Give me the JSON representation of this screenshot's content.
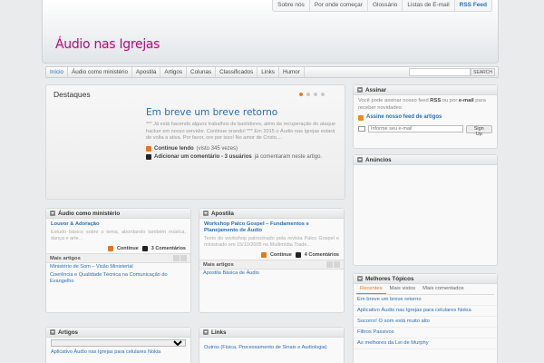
{
  "toplinks": [
    "Sobre nós",
    "Por onde começar",
    "Glossário",
    "Listas de E-mail",
    "RSS Feed"
  ],
  "logo": "Áudio nas Igrejas",
  "nav": [
    "Início",
    "Áudio como ministério",
    "Apostila",
    "Artigos",
    "Colunas",
    "Classificados",
    "Links",
    "Humor"
  ],
  "search_button": "SEARCH",
  "featured": {
    "title": "Destaques",
    "article_title": "Em breve um breve retorno",
    "excerpt": "*** Já está havendo alguns trabalhos de bastidores, além da recuperação do ataque hacker em nosso servidor. Continue orando! *** Em 2015 o Áudio nas Igrejas estará de volta a ativa. Por favor, ore por isso! No amor de Cristo,...",
    "read_more": "Continue lendo",
    "views": "(visto 345 vezes)",
    "comment": "Adicionar um comentário - 3 usuários",
    "comment_suffix": "já comentaram neste artigo."
  },
  "col1": {
    "header": "Áudio como ministério",
    "post_title": "Louvor & Adoração",
    "excerpt": "Estudo básico sobre o tema, abordando também música, dança e arte...",
    "continue": "Continue",
    "comments": "3 Comentários",
    "more_label": "Mais artigos",
    "more_links": [
      "Ministério de Som – Visão Ministerial",
      "Coerência e Qualidade Técnica na Comunicação do Evangelho"
    ]
  },
  "col2": {
    "header": "Apostila",
    "post_title": "Workshop Palco Gospel – Fundamentos e Planejamento de Áudio",
    "excerpt": "Texto do workshop patrocinado pela revista Palco Gospel e ministrado em 15/10/2005 no Multimídia Trade...",
    "continue": "Continue",
    "comments": "4 Comentários",
    "more_label": "Mais artigos",
    "more_links": [
      "Apostila Básica de Áudio"
    ]
  },
  "artigos": {
    "header": "Artigos",
    "first_link": "Aplicativo Áudio nas Igrejas para celulares Nokia"
  },
  "links": {
    "header": "Links",
    "first_link": "Outros (Física, Processamento de Sinais e Audiologia)"
  },
  "assinar": {
    "header": "Assinar",
    "text_a": "Você pode assinar nosso feed",
    "rss": "RSS",
    "text_b": "ou por",
    "email": "e-mail",
    "text_c": "para receber novidades:",
    "feed_link": "Assine nosso feed de artigos",
    "email_value": "Informe seu e-mail",
    "signup": "Sign Up"
  },
  "anuncios": {
    "header": "Anúncios"
  },
  "topicos": {
    "header": "Melhores Tópicos",
    "tabs": [
      "Recentes",
      "Mais vistos",
      "Mais comentados"
    ],
    "items": [
      "Em breve um breve retorno",
      "Aplicativo Áudio nas Igrejas para celulares Nokia",
      "Socorro! O som está muito alto",
      "Filtros Passivos",
      "As melhores da Lei de Murphy"
    ]
  }
}
